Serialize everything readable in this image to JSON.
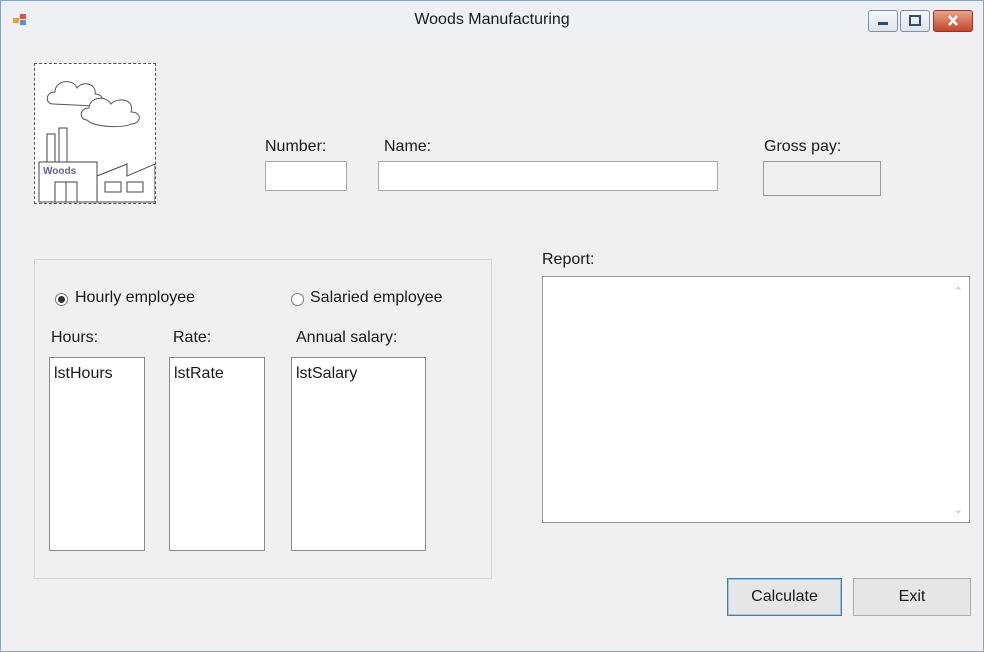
{
  "window": {
    "title": "Woods Manufacturing",
    "accent_color": "#3c7fb1",
    "close_color": "#c7452a"
  },
  "caption_buttons": [
    "minimize-icon",
    "maximize-icon",
    "close-icon"
  ],
  "logo": {
    "text": "Woods"
  },
  "header": {
    "number_label": "Number:",
    "name_label": "Name:",
    "gross_pay_label": "Gross pay:",
    "number_value": "",
    "name_value": "",
    "gross_pay_value": ""
  },
  "employee_group": {
    "hourly_label": "Hourly employee",
    "salaried_label": "Salaried employee",
    "selected": "hourly",
    "hours_label": "Hours:",
    "rate_label": "Rate:",
    "annual_salary_label": "Annual salary:",
    "hours_list": [
      "lstHours"
    ],
    "rate_list": [
      "lstRate"
    ],
    "salary_list": [
      "lstSalary"
    ]
  },
  "report": {
    "label": "Report:",
    "text": ""
  },
  "buttons": {
    "calculate_label": "Calculate",
    "exit_label": "Exit"
  }
}
